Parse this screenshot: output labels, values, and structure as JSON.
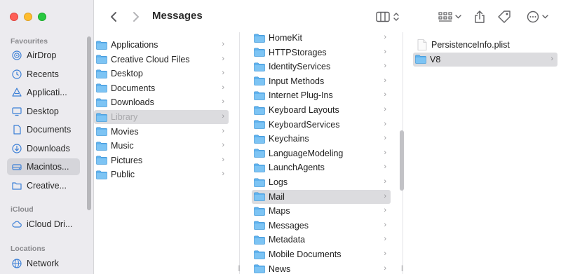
{
  "window": {
    "title": "Messages"
  },
  "sidebar": {
    "sections": [
      {
        "label": "Favourites"
      },
      {
        "label": "iCloud"
      },
      {
        "label": "Locations"
      }
    ],
    "favourites": [
      {
        "label": "AirDrop",
        "icon": "airdrop-icon"
      },
      {
        "label": "Recents",
        "icon": "clock-icon"
      },
      {
        "label": "Applicati...",
        "icon": "applications-icon"
      },
      {
        "label": "Desktop",
        "icon": "desktop-icon"
      },
      {
        "label": "Documents",
        "icon": "document-icon"
      },
      {
        "label": "Downloads",
        "icon": "download-icon"
      },
      {
        "label": "Macintos...",
        "icon": "hard-drive-icon",
        "selected": true
      },
      {
        "label": "Creative...",
        "icon": "folder-icon"
      }
    ],
    "icloud": [
      {
        "label": "iCloud Dri...",
        "icon": "cloud-icon"
      }
    ],
    "locations": [
      {
        "label": "Network",
        "icon": "network-icon"
      }
    ]
  },
  "columns": [
    {
      "items": [
        {
          "label": "Applications"
        },
        {
          "label": "Creative Cloud Files"
        },
        {
          "label": "Desktop"
        },
        {
          "label": "Documents"
        },
        {
          "label": "Downloads"
        },
        {
          "label": "Library",
          "selected": true,
          "dimmed": true
        },
        {
          "label": "Movies"
        },
        {
          "label": "Music"
        },
        {
          "label": "Pictures"
        },
        {
          "label": "Public"
        }
      ]
    },
    {
      "items": [
        {
          "label": "HomeKit"
        },
        {
          "label": "HTTPStorages"
        },
        {
          "label": "IdentityServices"
        },
        {
          "label": "Input Methods"
        },
        {
          "label": "Internet Plug-Ins"
        },
        {
          "label": "Keyboard Layouts"
        },
        {
          "label": "KeyboardServices"
        },
        {
          "label": "Keychains"
        },
        {
          "label": "LanguageModeling"
        },
        {
          "label": "LaunchAgents"
        },
        {
          "label": "Logs"
        },
        {
          "label": "Mail",
          "selected": true
        },
        {
          "label": "Maps"
        },
        {
          "label": "Messages"
        },
        {
          "label": "Metadata"
        },
        {
          "label": "Mobile Documents"
        },
        {
          "label": "News"
        }
      ]
    },
    {
      "items": [
        {
          "label": "PersistenceInfo.plist",
          "type": "file"
        },
        {
          "label": "V8",
          "type": "folder",
          "selected": true
        }
      ]
    }
  ],
  "colors": {
    "folder": "#4fa7e6",
    "selection": "#dcdcdf",
    "sidebar_bg": "#ecebef"
  }
}
